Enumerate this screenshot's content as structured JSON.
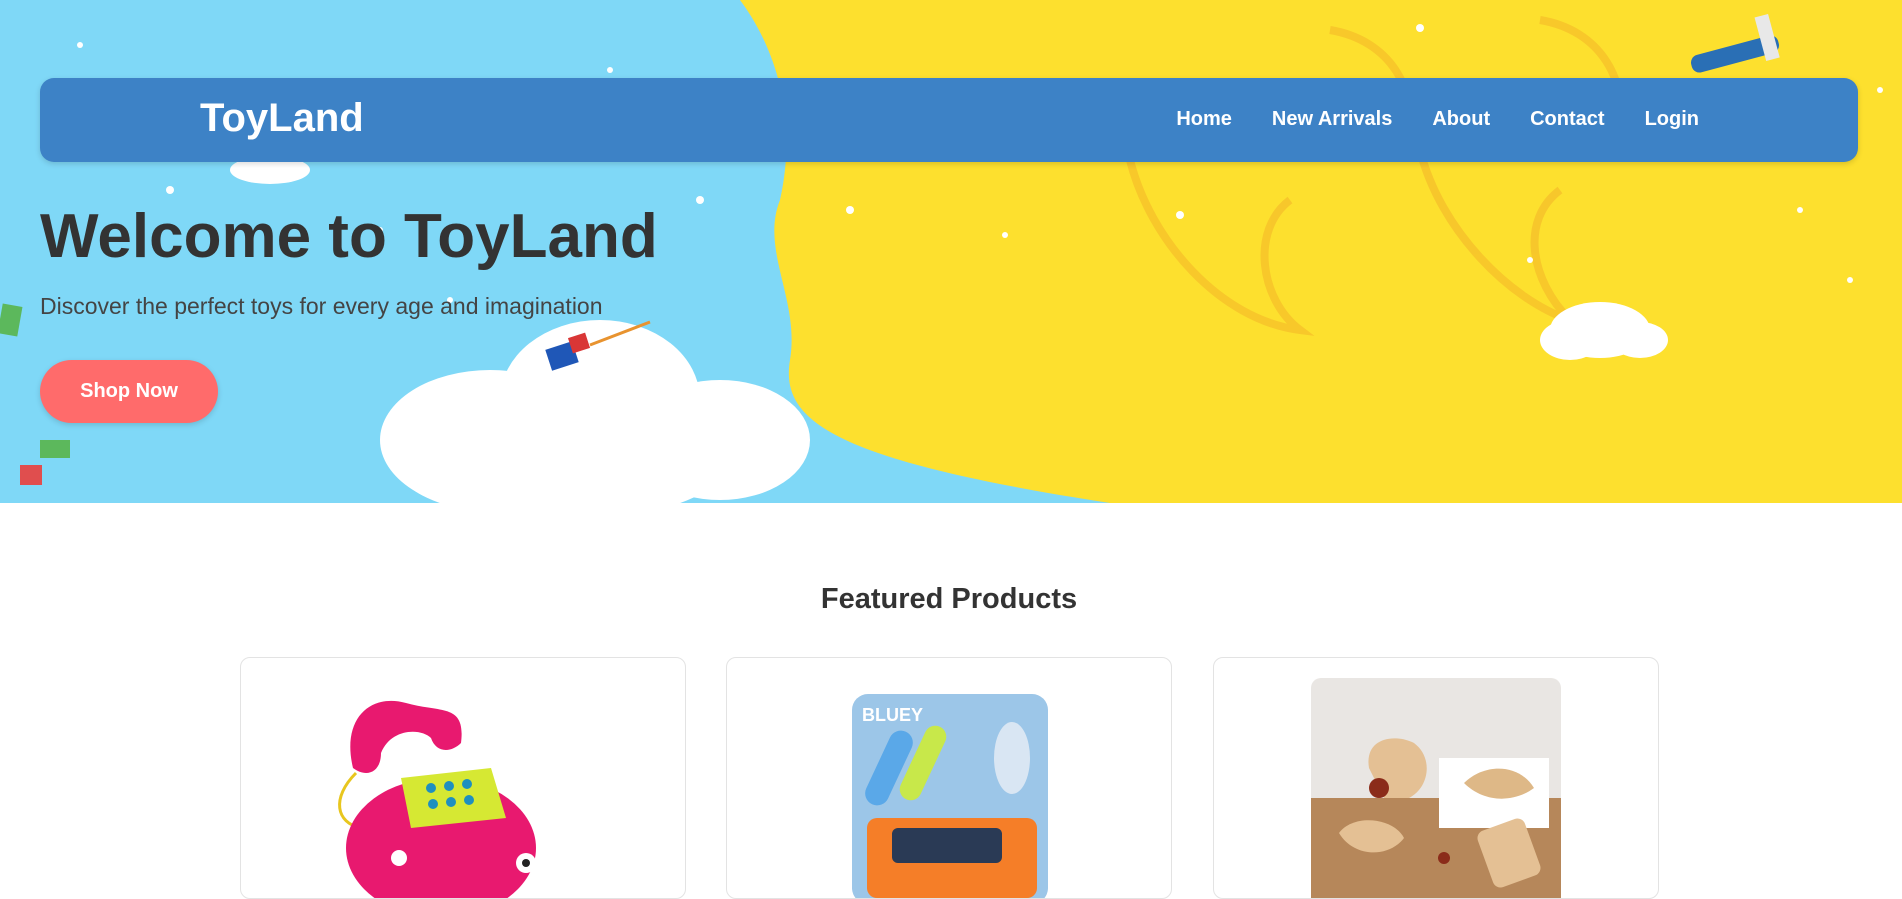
{
  "nav": {
    "brand": "ToyLand",
    "links": [
      "Home",
      "New Arrivals",
      "About",
      "Contact",
      "Login"
    ]
  },
  "hero": {
    "title": "Welcome to ToyLand",
    "subtitle": "Discover the perfect toys for every age and imagination",
    "cta_label": "Shop Now"
  },
  "featured": {
    "title": "Featured Products",
    "products": [
      {
        "image": "pink-toy-telephone-image"
      },
      {
        "image": "bluey-surf-car-playset-image"
      },
      {
        "image": "wooden-baby-toys-image"
      }
    ],
    "box_logo": "BLUEY"
  },
  "colors": {
    "nav_bg": "#3d82c6",
    "cta_bg": "#ff6b6b",
    "sky_blue": "#7fd8f7",
    "sunshine_yellow": "#fde02e"
  }
}
